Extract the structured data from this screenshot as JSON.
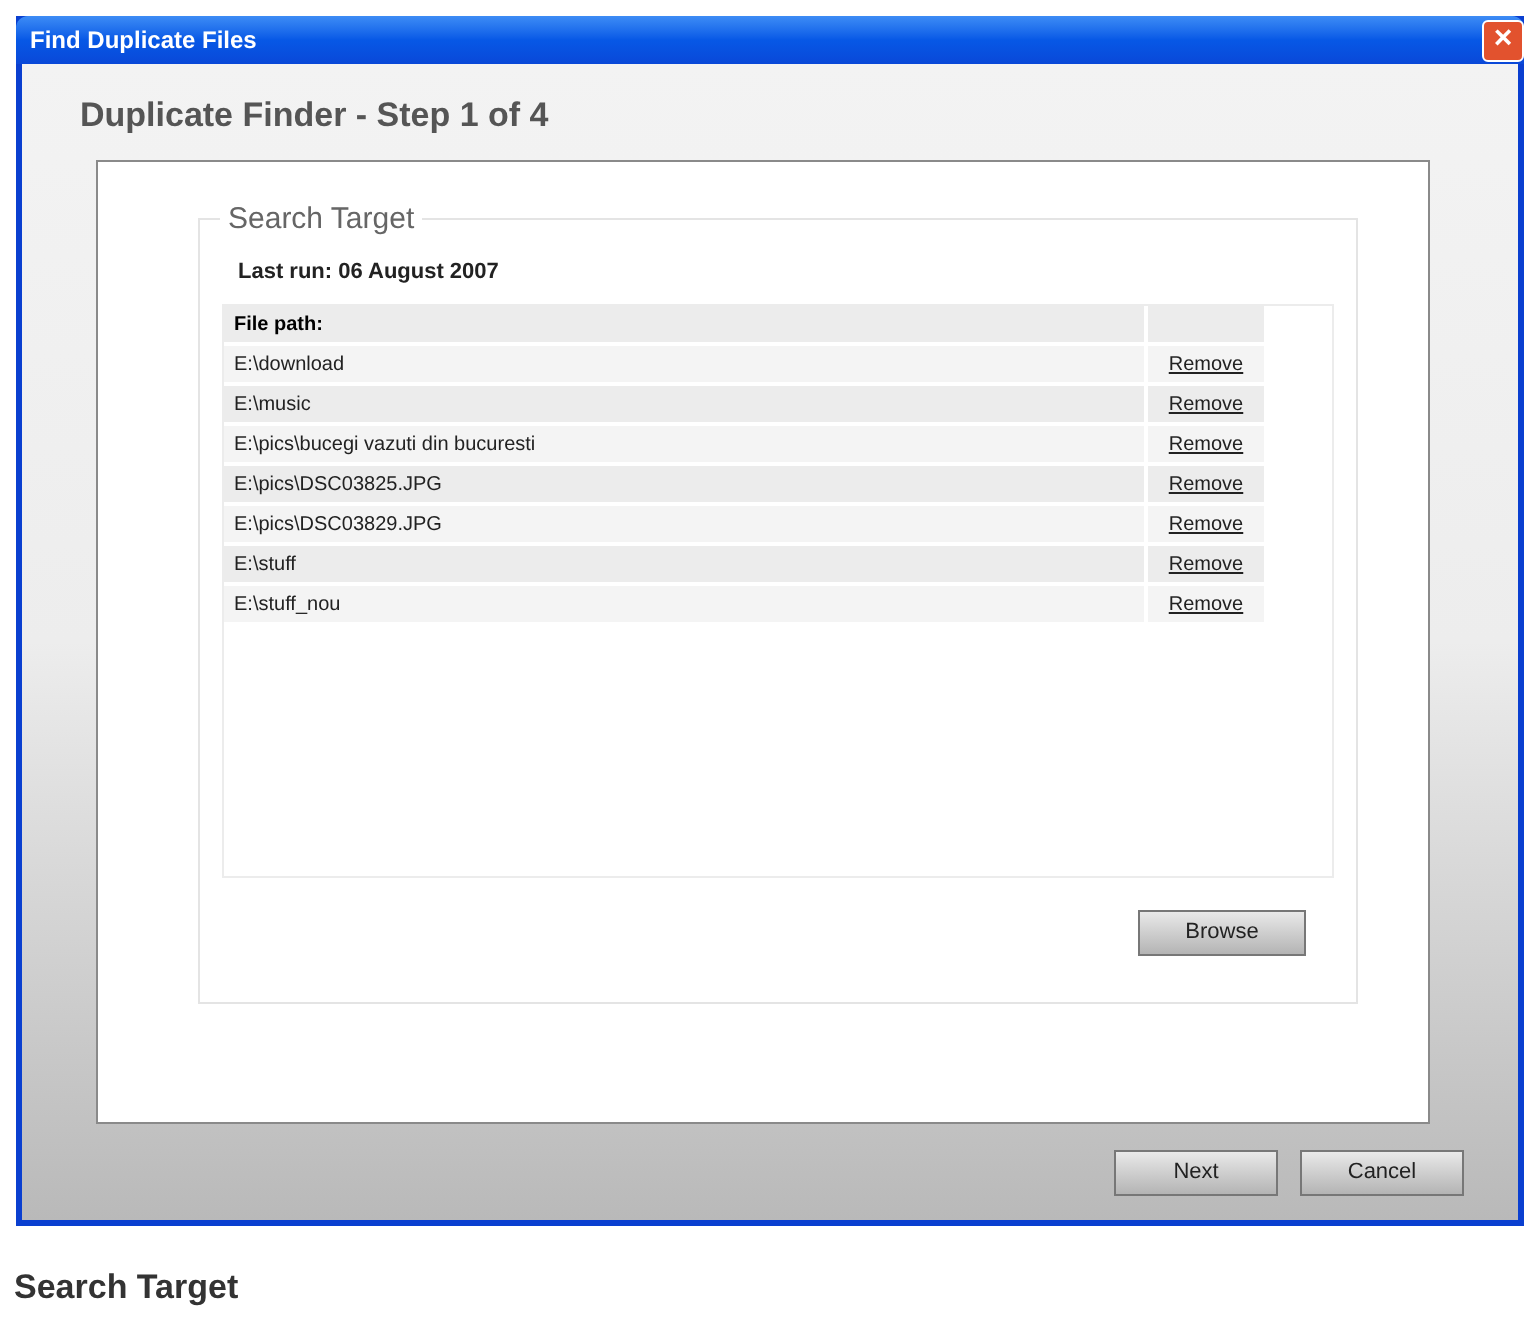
{
  "window": {
    "title": "Find Duplicate Files",
    "close": "×"
  },
  "header": "Duplicate Finder - Step 1 of 4",
  "group": {
    "legend": "Search Target",
    "last_run": "Last run: 06 August 2007"
  },
  "table": {
    "columns": [
      "File path:"
    ],
    "rows": [
      {
        "path": "E:\\download",
        "action": "Remove"
      },
      {
        "path": "E:\\music",
        "action": "Remove"
      },
      {
        "path": "E:\\pics\\bucegi vazuti din bucuresti",
        "action": "Remove"
      },
      {
        "path": "E:\\pics\\DSC03825.JPG",
        "action": "Remove"
      },
      {
        "path": "E:\\pics\\DSC03829.JPG",
        "action": "Remove"
      },
      {
        "path": "E:\\stuff",
        "action": "Remove"
      },
      {
        "path": "E:\\stuff_nou",
        "action": "Remove"
      }
    ]
  },
  "browse_button": "Browse",
  "buttons": [
    "Next",
    "Cancel"
  ],
  "caption": "Search Target"
}
